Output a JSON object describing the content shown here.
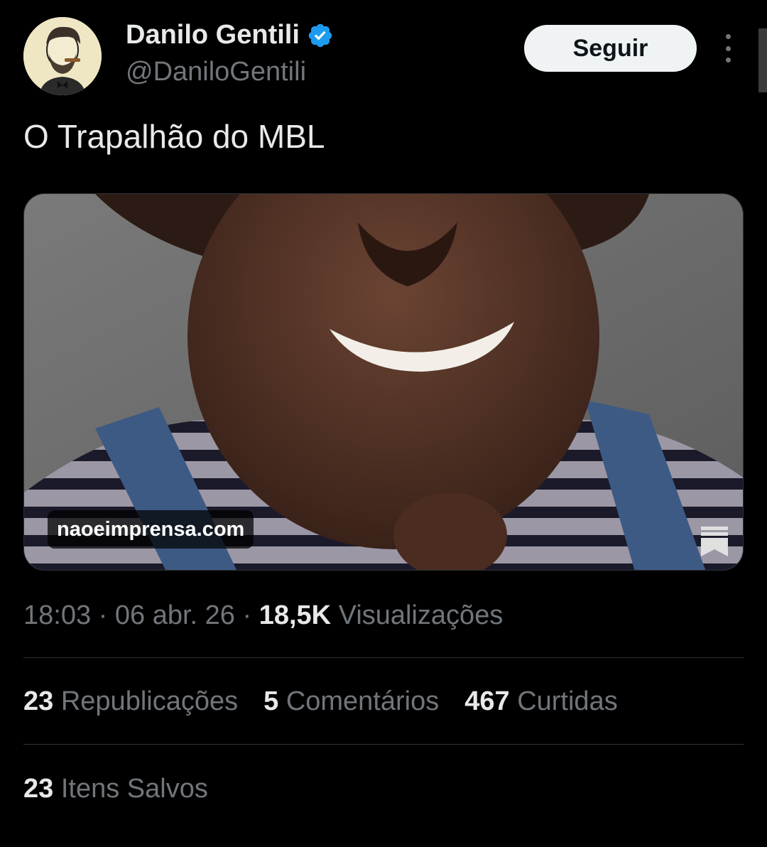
{
  "author": {
    "name": "Danilo Gentili",
    "handle": "@DaniloGentili",
    "verified": true,
    "avatar_icon": "cartoon-portrait-avatar"
  },
  "actions": {
    "follow_label": "Seguir",
    "more_icon": "more-vertical-icon"
  },
  "tweet": {
    "text": "O Trapalhão do MBL"
  },
  "media": {
    "domain": "naoeimprensa.com",
    "bookmark_icon": "bookmark-icon"
  },
  "meta": {
    "time": "18:03",
    "sep1": "·",
    "date": "06 abr. 26",
    "sep2": "·",
    "views_count": "18,5K",
    "views_label": "Visualizações"
  },
  "stats": {
    "reposts_count": "23",
    "reposts_label": "Republicações",
    "comments_count": "5",
    "comments_label": "Comentários",
    "likes_count": "467",
    "likes_label": "Curtidas",
    "saved_count": "23",
    "saved_label": "Itens Salvos"
  },
  "colors": {
    "background": "#000000",
    "text": "#e7e9ea",
    "muted": "#71767b",
    "verified_blue": "#1d9bf0",
    "divider": "#2f3336"
  }
}
